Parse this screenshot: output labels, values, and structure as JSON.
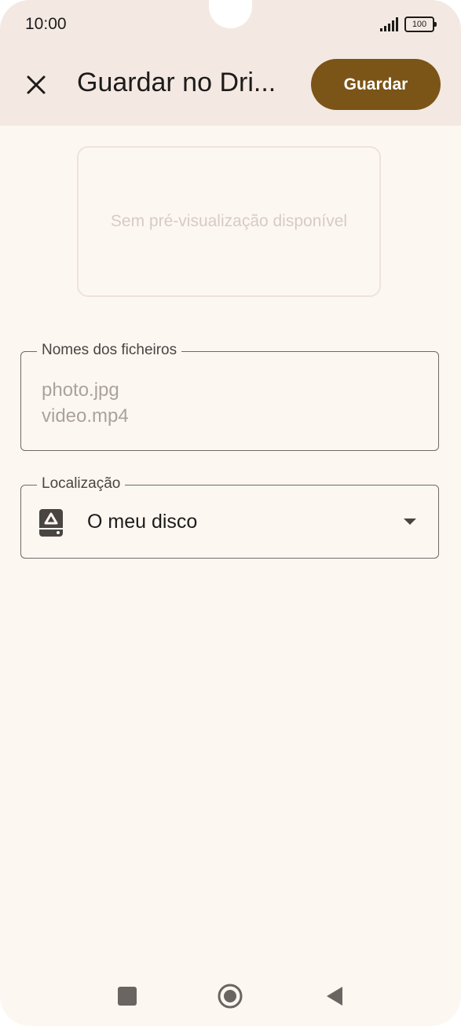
{
  "status_bar": {
    "time": "10:00",
    "battery": "100"
  },
  "app_bar": {
    "close_icon": "close-icon",
    "title": "Guardar no Dri...",
    "save_label": "Guardar",
    "save_color": "#7b5417"
  },
  "preview": {
    "placeholder": "Sem pré-visualização disponível"
  },
  "filenames": {
    "label": "Nomes dos ficheiros",
    "files": [
      "photo.jpg",
      "video.mp4"
    ]
  },
  "location": {
    "label": "Localização",
    "value": "O meu disco",
    "icon": "drive-icon"
  },
  "nav_bar": {
    "recents_icon": "square-icon",
    "home_icon": "circle-icon",
    "back_icon": "triangle-back-icon"
  }
}
